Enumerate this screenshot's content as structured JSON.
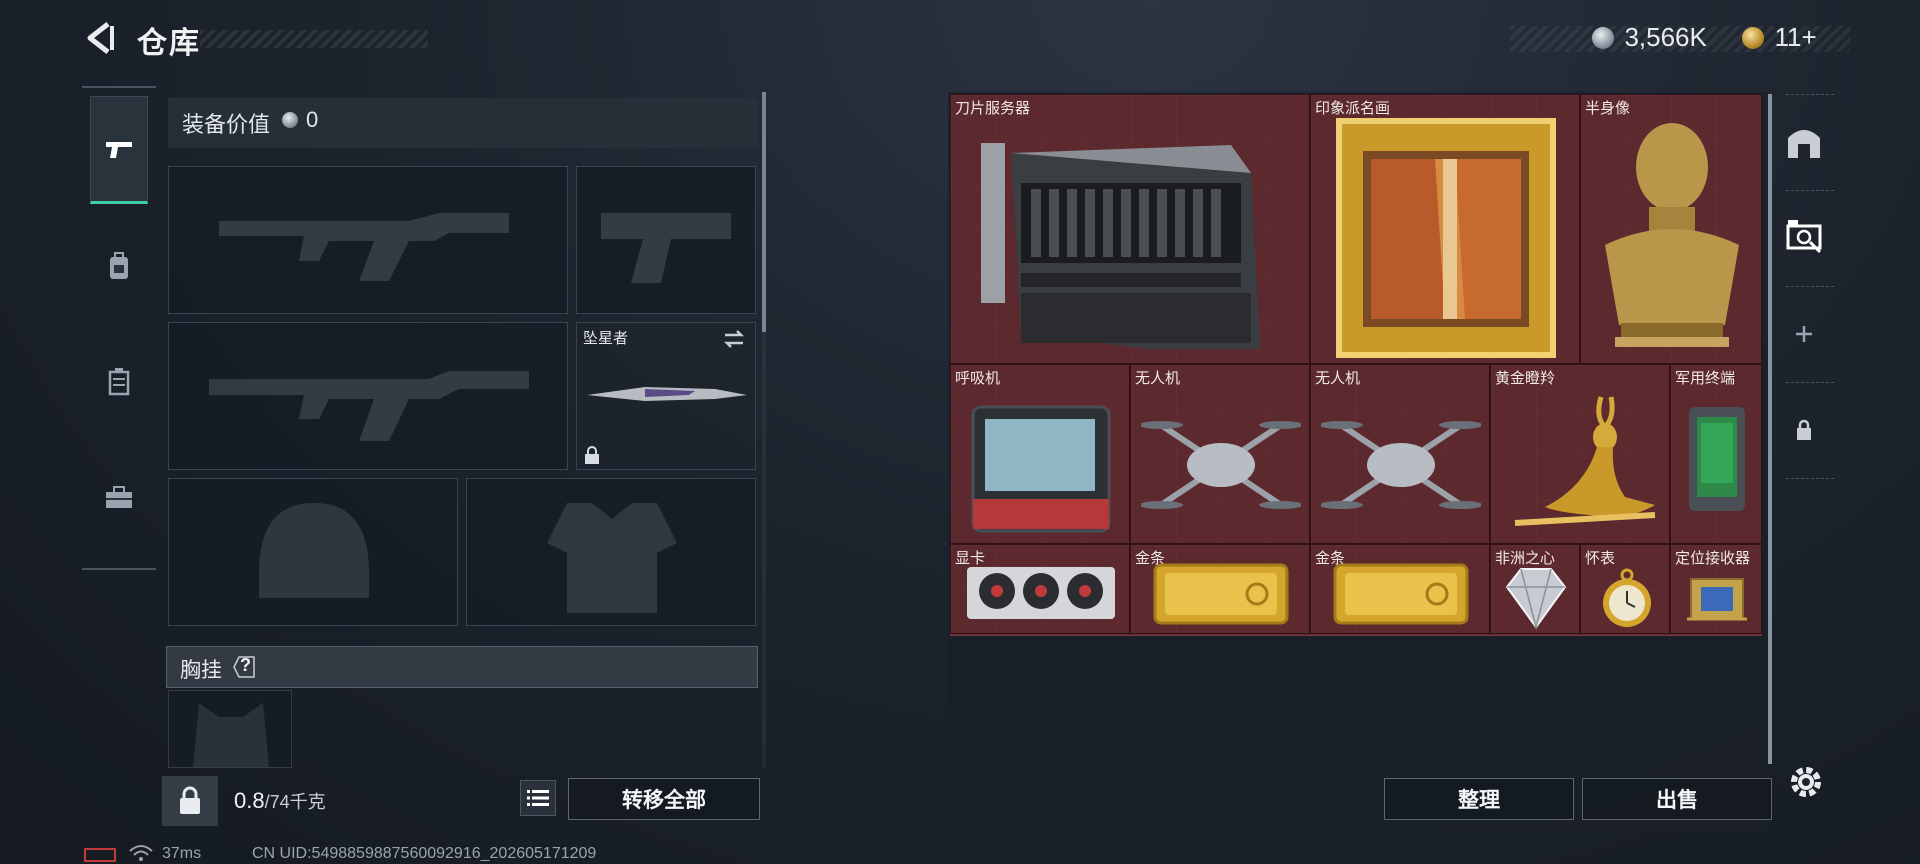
{
  "header": {
    "title": "仓库",
    "currency_silver": "3,566K",
    "currency_gold": "11+"
  },
  "loadout": {
    "equip_value_label": "装备价值",
    "equip_value": "0",
    "melee_slot_name": "坠星者",
    "chest_rig_label": "胸挂",
    "help_symbol": "?",
    "weight_current": "0.8",
    "weight_max": "/74千克",
    "transfer_all_label": "转移全部"
  },
  "stash": {
    "items": [
      {
        "name": "刀片服务器",
        "icon": "blade-server-icon"
      },
      {
        "name": "印象派名画",
        "icon": "impressionist-painting-icon"
      },
      {
        "name": "半身像",
        "icon": "bust-statue-icon"
      },
      {
        "name": "呼吸机",
        "icon": "ventilator-icon"
      },
      {
        "name": "无人机",
        "icon": "drone-icon"
      },
      {
        "name": "无人机",
        "icon": "drone-icon"
      },
      {
        "name": "黄金瞪羚",
        "icon": "golden-gazelle-icon"
      },
      {
        "name": "军用终端",
        "icon": "military-terminal-icon"
      },
      {
        "name": "显卡",
        "icon": "graphics-card-icon"
      },
      {
        "name": "金条",
        "icon": "gold-bar-icon"
      },
      {
        "name": "金条",
        "icon": "gold-bar-icon"
      },
      {
        "name": "非洲之心",
        "icon": "heart-of-africa-gem-icon"
      },
      {
        "name": "怀表",
        "icon": "pocket-watch-icon"
      },
      {
        "name": "定位接收器",
        "icon": "locator-receiver-icon"
      }
    ],
    "sort_label": "整理",
    "sell_label": "出售"
  },
  "footer": {
    "ping": "37ms",
    "uid": "CN UID:5498859887560092916_202605171209"
  },
  "colors": {
    "accent": "#3fd0a5",
    "stash_bg": "#5a2a2f",
    "battery_low": "#c23a3a"
  }
}
